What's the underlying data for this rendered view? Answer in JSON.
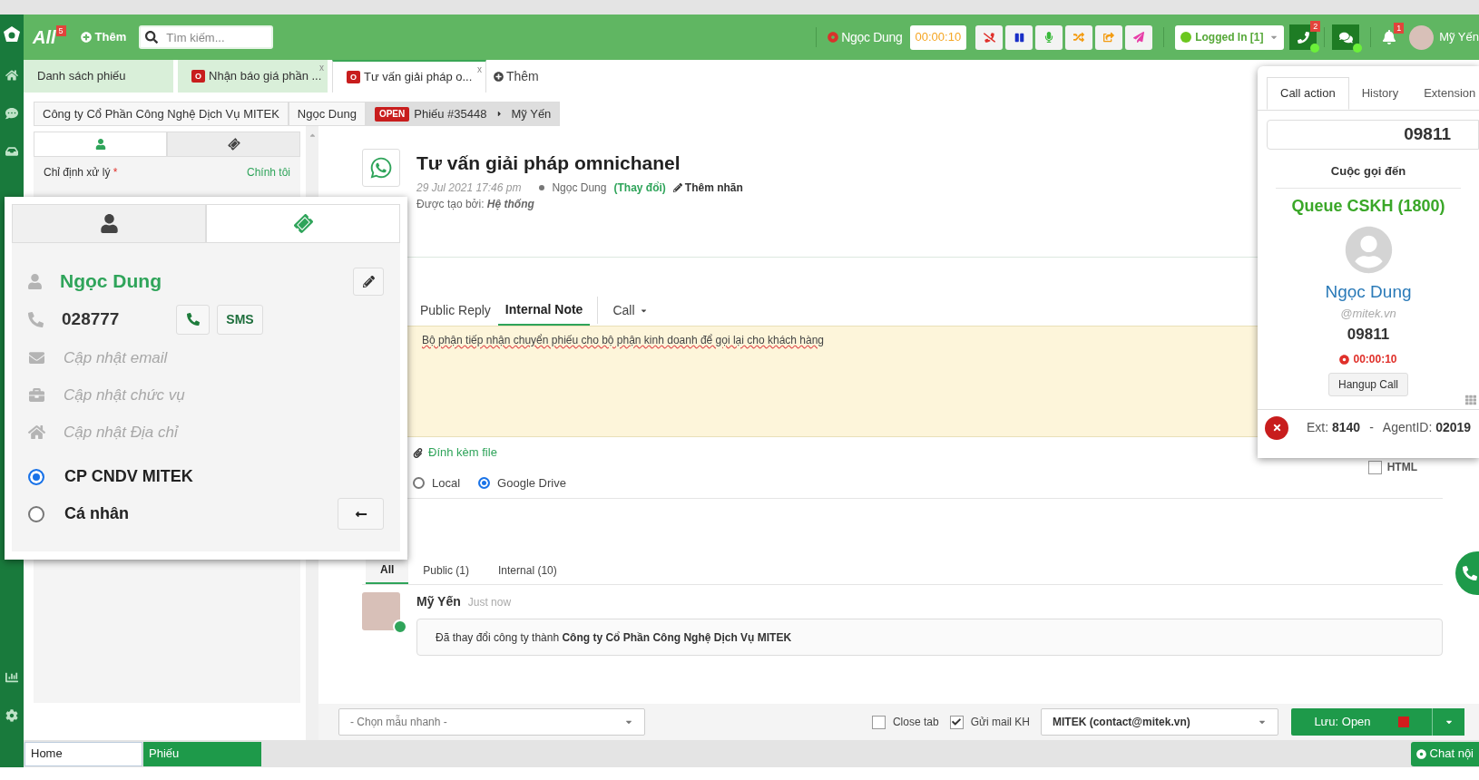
{
  "topbar": {
    "brand": "All",
    "brand_badge": "5",
    "add_label": "Thêm",
    "search": {
      "placeholder": "Tìm kiếm..."
    },
    "caller": "Ngọc Dung",
    "timer": "00:00:10",
    "status": "Logged In [1]",
    "phone_badge": "2",
    "bell_badge": "1",
    "user": "Mỹ Yến"
  },
  "tabs": [
    {
      "label": "Danh sách phiếu",
      "selected": false
    },
    {
      "label": "Nhận báo giá phần ...",
      "badge": "O",
      "close": "x",
      "selected": false
    },
    {
      "label": "Tư vấn giải pháp o...",
      "badge": "O",
      "close": "x",
      "selected": true
    }
  ],
  "new_tab": "Thêm",
  "breadcrumb": {
    "company": "Công ty Cổ Phần Công Nghệ Dịch Vụ MITEK",
    "contact": "Ngọc Dung",
    "status": "OPEN",
    "ticket": "Phiếu #35448",
    "assignee": "Mỹ Yến"
  },
  "side_panel": {
    "tabs": [
      {
        "kind": "contact",
        "selected": true
      },
      {
        "kind": "ticket",
        "selected": false
      }
    ],
    "assign_label": "Chỉ định xử lý",
    "assign_required": "*",
    "assign_value": "Chính tôi"
  },
  "contact_popup": {
    "tabs": [
      {
        "kind": "contact",
        "selected": false
      },
      {
        "kind": "ticket",
        "selected": true
      }
    ],
    "name": "Ngọc Dung",
    "phone": "028777",
    "sms": "SMS",
    "fields": [
      {
        "kind": "email",
        "placeholder": "Cập nhật email"
      },
      {
        "kind": "position",
        "placeholder": "Cập nhật chức vụ"
      },
      {
        "kind": "address",
        "placeholder": "Cập nhật Địa chỉ"
      }
    ],
    "types": [
      {
        "label": "CP CNDV MITEK",
        "selected": true
      },
      {
        "label": "Cá nhân",
        "selected": false
      }
    ]
  },
  "ticket": {
    "title": "Tư vấn giải pháp omnichanel",
    "date": "29 Jul 2021 17:46 pm",
    "requester": "Ngọc Dung",
    "change": "(Thay đổi)",
    "add_tag": "Thêm nhãn",
    "created_by_label": "Được tạo bởi:",
    "created_by": "Hệ thống"
  },
  "reply": {
    "tabs": [
      {
        "kind": "tab",
        "label": "Public Reply",
        "selected": false
      },
      {
        "kind": "tab",
        "label": "Internal Note",
        "selected": true
      },
      {
        "kind": "dropdown",
        "label": "Call",
        "selected": false
      }
    ],
    "note": "Bộ phận tiếp nhận chuyển phiếu cho bộ phận kinh doanh để gọi lại cho khách hàng",
    "attach": "Đính kèm file",
    "storage": [
      {
        "label": "Local",
        "selected": false
      },
      {
        "label": "Google Drive",
        "selected": true
      }
    ],
    "html": {
      "label": "HTML",
      "checked": false
    }
  },
  "activity": {
    "tabs": [
      {
        "label": "All",
        "selected": true
      },
      {
        "label": "Public (1)",
        "selected": false
      },
      {
        "label": "Internal (10)",
        "selected": false
      }
    ],
    "entries": [
      {
        "author": "Mỹ Yến",
        "time": "Just now",
        "text": "Đã thay đổi công ty thành **Công ty Cổ Phần Công Nghệ Dịch Vụ MITEK**"
      }
    ]
  },
  "footer": {
    "template": {
      "placeholder": "- Chọn mẫu nhanh -"
    },
    "options": [
      {
        "label": "Close tab",
        "checked": false
      },
      {
        "label": "Gửi mail KH",
        "checked": true
      }
    ],
    "mailbox": "MITEK (contact@mitek.vn)",
    "save": "Lưu: Open"
  },
  "taskbar": {
    "items": [
      {
        "label": "Home",
        "selected": false
      },
      {
        "label": "Phiếu",
        "selected": true
      }
    ],
    "chat": "Chat nội"
  },
  "call_panel": {
    "tabs": [
      {
        "label": "Call action",
        "selected": true
      },
      {
        "label": "History",
        "selected": false
      },
      {
        "label": "Extension",
        "selected": false
      }
    ],
    "number": "09811",
    "heading": "Cuộc gọi đến",
    "queue": "Queue CSKH (1800)",
    "caller": "Ngọc Dung",
    "email": "@mitek.vn",
    "phone": "09811",
    "timer": "00:00:10",
    "hangup": "Hangup Call",
    "ext_label": "Ext:",
    "ext": "8140",
    "separator": "-",
    "agent_label": "AgentID:",
    "agent": "02019"
  }
}
